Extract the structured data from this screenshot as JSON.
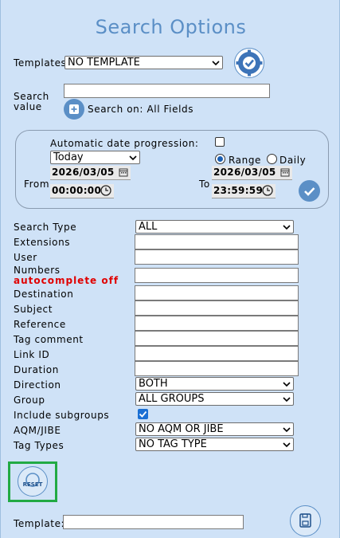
{
  "title": "Search Options",
  "templates": {
    "label": "Templates",
    "selected": "NO TEMPLATE"
  },
  "search_value": {
    "label_line1": "Search",
    "label_line2": "value",
    "value": "",
    "search_on": "Search on: All Fields"
  },
  "date": {
    "auto_progression_label": "Automatic date progression:",
    "preset": "Today",
    "from_label": "From",
    "to_label": "To",
    "from_date": "2026/03/05",
    "from_time": "00:00:00",
    "to_date": "2026/03/05",
    "to_time": "23:59:59",
    "range_label": "Range",
    "daily_label": "Daily"
  },
  "fields": {
    "search_type": {
      "label": "Search Type",
      "selected": "ALL"
    },
    "extensions": "Extensions",
    "user": "User",
    "numbers": "Numbers",
    "autocomplete": "autocomplete off",
    "destination": "Destination",
    "subject": "Subject",
    "reference": "Reference",
    "tag_comment": "Tag comment",
    "link_id": "Link ID",
    "duration": "Duration",
    "direction": {
      "label": "Direction",
      "selected": "BOTH"
    },
    "group": {
      "label": "Group",
      "selected": "ALL GROUPS"
    },
    "include_subgroups": "Include subgroups",
    "aqm_jibe": {
      "label": "AQM/JIBE",
      "selected": "NO AQM OR JIBE"
    },
    "tag_types": {
      "label": "Tag Types",
      "selected": "NO TAG TYPE"
    }
  },
  "reset_label": "RESET",
  "template_save": {
    "label": "Template:",
    "value": ""
  },
  "colors": {
    "panel": "#cfe2f7",
    "accent": "#5b8fc6",
    "highlight_border": "#22aa44",
    "warning": "#e00000"
  }
}
